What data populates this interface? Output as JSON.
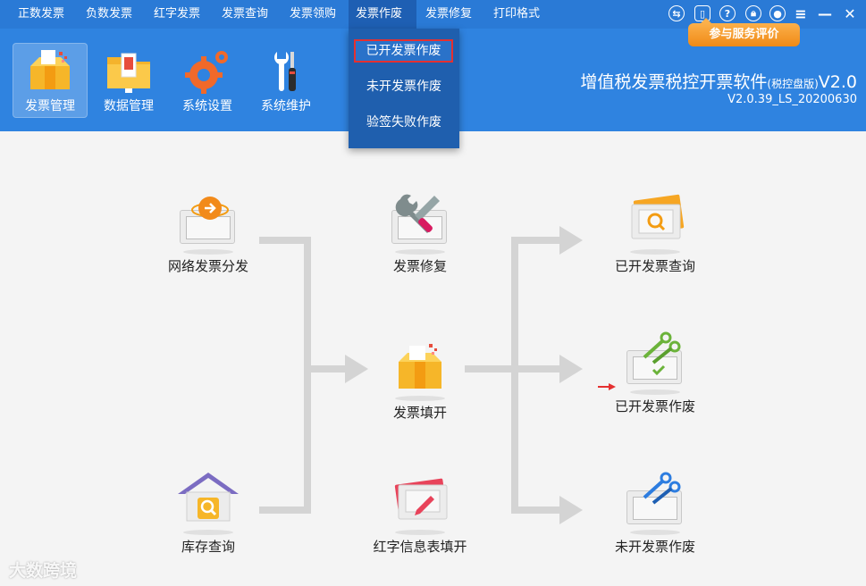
{
  "menu": {
    "items": [
      {
        "label": "正数发票"
      },
      {
        "label": "负数发票"
      },
      {
        "label": "红字发票"
      },
      {
        "label": "发票查询"
      },
      {
        "label": "发票领购"
      },
      {
        "label": "发票作废"
      },
      {
        "label": "发票修复"
      },
      {
        "label": "打印格式"
      }
    ],
    "active": "发票作废",
    "toolbar_icons": [
      "exchange-icon",
      "clipboard-icon",
      "help-icon",
      "lock-icon",
      "user-icon",
      "menu-icon",
      "minimize-icon",
      "close-icon"
    ]
  },
  "dropdown": {
    "items": [
      {
        "label": "已开发票作废"
      },
      {
        "label": "未开发票作废"
      },
      {
        "label": "验签失败作废"
      }
    ],
    "highlighted": "已开发票作废"
  },
  "service_button": {
    "label": "参与服务评价"
  },
  "toolbar": {
    "buttons": [
      {
        "label": "发票管理",
        "icon": "invoice-box-icon"
      },
      {
        "label": "数据管理",
        "icon": "folder-icon"
      },
      {
        "label": "系统设置",
        "icon": "gear-icon"
      },
      {
        "label": "系统维护",
        "icon": "tools-icon"
      }
    ],
    "active": "发票管理"
  },
  "app": {
    "title": "增值税发票税控开票软件",
    "edition": "(税控盘版)",
    "version_suffix": "V2.0",
    "version": "V2.0.39_LS_20200630"
  },
  "flow": {
    "nodes": [
      {
        "label": "网络发票分发",
        "icon": "network-distribute-icon"
      },
      {
        "label": "库存查询",
        "icon": "warehouse-search-icon"
      },
      {
        "label": "发票修复",
        "icon": "wrench-ticket-icon"
      },
      {
        "label": "发票填开",
        "icon": "invoice-box-icon"
      },
      {
        "label": "红字信息表填开",
        "icon": "red-form-pen-icon"
      },
      {
        "label": "已开发票查询",
        "icon": "ticket-search-icon"
      },
      {
        "label": "已开发票作废",
        "icon": "ticket-scissors-green-icon"
      },
      {
        "label": "未开发票作废",
        "icon": "ticket-scissors-blue-icon"
      }
    ]
  },
  "colors": {
    "menubar": "#2a7ad6",
    "header": "#2f83e0",
    "dropdown": "#1f5fae",
    "highlight_border": "#e53030",
    "flow_line": "#d4d4d4",
    "service_button": "#f59a2a"
  },
  "watermark": "大数跨境"
}
